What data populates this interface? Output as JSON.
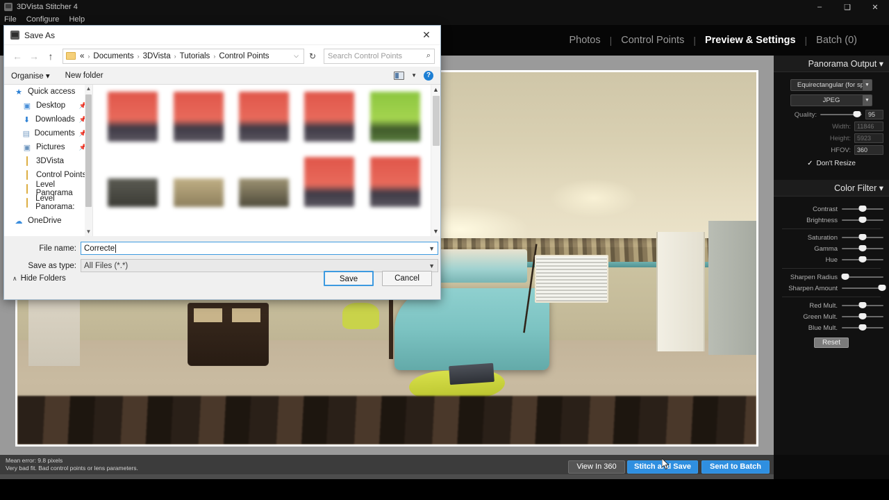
{
  "app": {
    "title": "3DVista Stitcher 4",
    "menu": [
      "File",
      "Configure",
      "Help"
    ],
    "window_controls": {
      "minimize": "–",
      "maximize": "❑",
      "close": "✕"
    }
  },
  "tabs": [
    {
      "label": "Photos",
      "active": false
    },
    {
      "label": "Control Points",
      "active": false
    },
    {
      "label": "Preview & Settings",
      "active": true
    },
    {
      "label": "Batch (0)",
      "active": false
    }
  ],
  "tab_separator": "|",
  "panorama_output": {
    "header": "Panorama Output ▾",
    "projection": "Equirectangular (for spl",
    "format": "JPEG",
    "quality_label": "Quality:",
    "quality_value": "95",
    "width_label": "Width:",
    "width_value": "11846",
    "height_label": "Height:",
    "height_value": "5923",
    "hfov_label": "HFOV:",
    "hfov_value": "360",
    "dont_resize_label": "Don't Resize",
    "dont_resize_checked": true
  },
  "color_filter": {
    "header": "Color Filter ▾",
    "rows": [
      {
        "label": "Contrast",
        "pos": 50
      },
      {
        "label": "Brightness",
        "pos": 50
      },
      {
        "label": "Saturation",
        "pos": 50
      },
      {
        "label": "Gamma",
        "pos": 50
      },
      {
        "label": "Hue",
        "pos": 50
      },
      {
        "label": "Sharpen Radius",
        "pos": 8
      },
      {
        "label": "Sharpen Amount",
        "pos": 96
      },
      {
        "label": "Red Mult.",
        "pos": 50
      },
      {
        "label": "Green Mult.",
        "pos": 50
      },
      {
        "label": "Blue Mult.",
        "pos": 50
      }
    ],
    "reset_label": "Reset"
  },
  "status": {
    "line1": "Mean error: 9.8 pixels",
    "line2": "Very bad fit. Bad control points or lens parameters."
  },
  "actions": {
    "view_in_360": "View In 360",
    "stitch_and_save": "Stitch and Save",
    "send_to_batch": "Send to Batch"
  },
  "dialog": {
    "title": "Save As",
    "close": "✕",
    "nav": {
      "back": "←",
      "forward": "→",
      "up": "↑",
      "refresh": "↻"
    },
    "breadcrumb": [
      "«",
      "Documents",
      "3DVista",
      "Tutorials",
      "Control Points"
    ],
    "breadcrumb_chevron": "›",
    "address_dropdown": "⌵",
    "search_placeholder": "Search Control Points",
    "search_icon": "⌕",
    "toolbar": {
      "organise": "Organise ▾",
      "new_folder": "New folder",
      "help": "?"
    },
    "sidebar": [
      {
        "label": "Quick access",
        "glyph": "★",
        "type": "star",
        "pin": ""
      },
      {
        "label": "Desktop",
        "glyph": "■",
        "type": "desktop",
        "pin": "📌"
      },
      {
        "label": "Downloads",
        "glyph": "⬇",
        "type": "download",
        "pin": "📌"
      },
      {
        "label": "Documents",
        "glyph": "▤",
        "type": "document",
        "pin": "📌"
      },
      {
        "label": "Pictures",
        "glyph": "▣",
        "type": "picture",
        "pin": "📌"
      },
      {
        "label": "3DVista",
        "glyph": "",
        "type": "folder",
        "pin": ""
      },
      {
        "label": "Control Points",
        "glyph": "",
        "type": "folder",
        "pin": ""
      },
      {
        "label": "Level Panorama",
        "glyph": "",
        "type": "folder",
        "pin": ""
      },
      {
        "label": "Level Panorama:",
        "glyph": "",
        "type": "folder",
        "pin": ""
      },
      {
        "label": "OneDrive",
        "glyph": "☁",
        "type": "cloud",
        "pin": ""
      }
    ],
    "thumbnails": [
      {
        "kind": "red"
      },
      {
        "kind": "red"
      },
      {
        "kind": "red"
      },
      {
        "kind": "red"
      },
      {
        "kind": "green"
      },
      {
        "kind": "gray"
      },
      {
        "kind": "tan"
      },
      {
        "kind": "tan2"
      },
      {
        "kind": "red"
      },
      {
        "kind": "red"
      }
    ],
    "file_name_label": "File name:",
    "file_name_value": "Correcte",
    "save_as_type_label": "Save as type:",
    "save_as_type_value": "All Files (*.*)",
    "hide_folders": "Hide Folders",
    "hide_folders_chevron": "∧",
    "save_button": "Save",
    "cancel_button": "Cancel"
  }
}
